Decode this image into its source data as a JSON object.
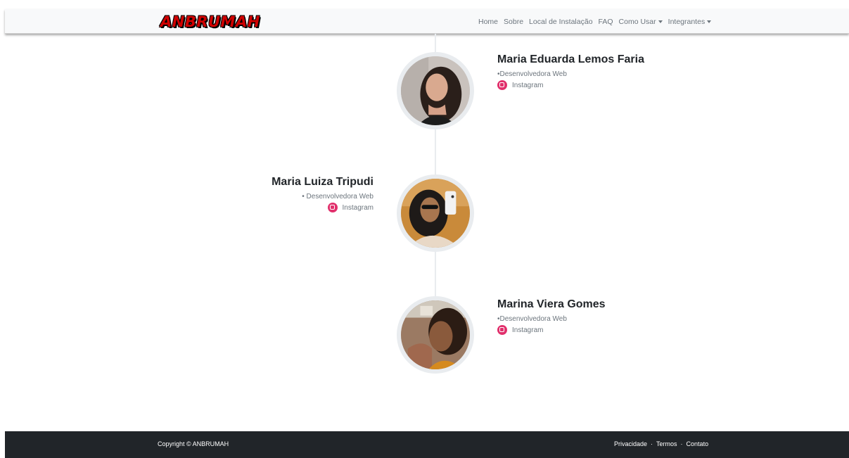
{
  "navbar": {
    "brand": "ANBRUMAH",
    "links": [
      {
        "label": "Home"
      },
      {
        "label": "Sobre"
      },
      {
        "label": "Local de Instalação"
      },
      {
        "label": "FAQ"
      },
      {
        "label": "Como Usar",
        "dropdown": true
      },
      {
        "label": "Integrantes",
        "dropdown": true
      }
    ]
  },
  "members": [
    {
      "name": "Maria Eduarda Lemos Faria",
      "role": "•Desenvolvedora Web",
      "social": "Instagram",
      "photo": "member-photo"
    },
    {
      "name": "Maria Luiza Tripudi",
      "role": "• Desenvolvedora Web",
      "social": "Instagram",
      "photo": "member-photo"
    },
    {
      "name": "Marina Viera Gomes",
      "role": "•Desenvolvedora Web",
      "social": "Instagram",
      "photo": "member-photo"
    }
  ],
  "footer": {
    "copyright": "Copyright © ANBRUMAH",
    "links": [
      "Privacidade",
      "Termos",
      "Contato"
    ],
    "separator": "·"
  },
  "colors": {
    "navbar_bg": "#f8f9fa",
    "footer_bg": "#212529",
    "instagram": "#e1306c",
    "brand": "#d10000"
  }
}
